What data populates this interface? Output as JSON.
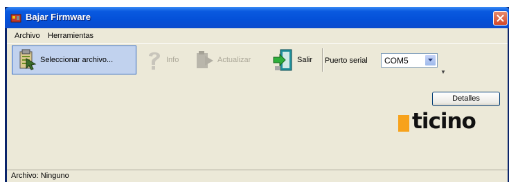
{
  "window": {
    "title": "Bajar Firmware"
  },
  "menu": {
    "items": [
      "Archivo",
      "Herramientas"
    ]
  },
  "toolbar": {
    "select_file_label": "Seleccionar archivo...",
    "info_label": "Info",
    "update_label": "Actualizar",
    "exit_label": "Salir",
    "port_label": "Puerto serial",
    "port_value": "COM5"
  },
  "details_label": "Detalles",
  "brand": {
    "logo_text": "ticino"
  },
  "status": {
    "text": "Archivo: Ninguno"
  },
  "colors": {
    "title_bar": "#0a5ae0",
    "client_bg": "#ece9d8",
    "logo_accent": "#f7a21b",
    "selected_bg": "#c1d2ee"
  },
  "icons": [
    "app-icon",
    "close-icon",
    "open-file-icon",
    "help-icon",
    "update-icon",
    "exit-door-icon",
    "dropdown-arrow-icon"
  ]
}
